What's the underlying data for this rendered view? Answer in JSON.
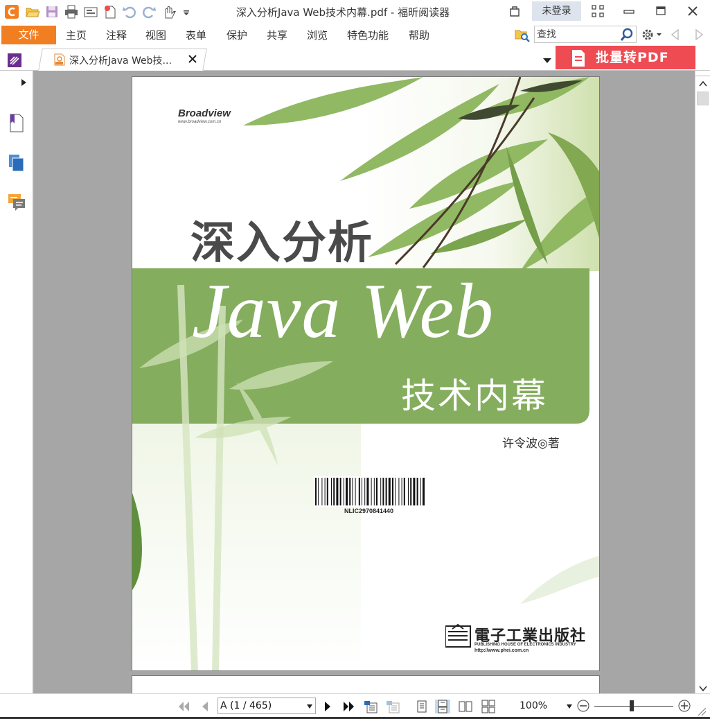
{
  "app": {
    "window_title": "深入分析Java Web技术内幕.pdf - 福昕阅读器",
    "login_label": "未登录"
  },
  "menu": {
    "file_label": "文件",
    "items": [
      "主页",
      "注释",
      "视图",
      "表单",
      "保护",
      "共享",
      "浏览",
      "特色功能",
      "帮助"
    ]
  },
  "search": {
    "placeholder": "查找",
    "value": ""
  },
  "tabs": {
    "active_label": "深入分析Java Web技...",
    "batch_label": "批量转PDF"
  },
  "cover": {
    "brand": "Broadview",
    "brand_url": "www.broadview.com.cn",
    "title_cn": "深入分析",
    "title_en": "Java Web",
    "subtitle": "技术内幕",
    "author": "许令波◎著",
    "barcode_text": "NLIC2970841440",
    "publisher_cn": "電子工業出版社",
    "publisher_en": "PUBLISHING HOUSE OF ELECTRONICS INDUSTRY",
    "publisher_url": "http://www.phei.com.cn"
  },
  "status": {
    "page_indicator": "A (1 / 465)",
    "zoom": "100%",
    "zoom_fraction": 0.47
  },
  "colors": {
    "accent_orange": "#f17f22",
    "batch_red": "#ee4b53",
    "cover_green": "#84ad5e",
    "doc_background": "#a6a6a6"
  },
  "icons": {
    "quick_access": [
      "foxit-logo-icon",
      "open-folder-icon",
      "save-icon",
      "print-icon",
      "scan-icon",
      "new-file-icon",
      "undo-icon",
      "redo-icon",
      "hand-tool-icon",
      "customize-dropdown-icon"
    ],
    "left_panel": [
      "bookmark-icon",
      "pages-icon",
      "comments-icon"
    ]
  }
}
